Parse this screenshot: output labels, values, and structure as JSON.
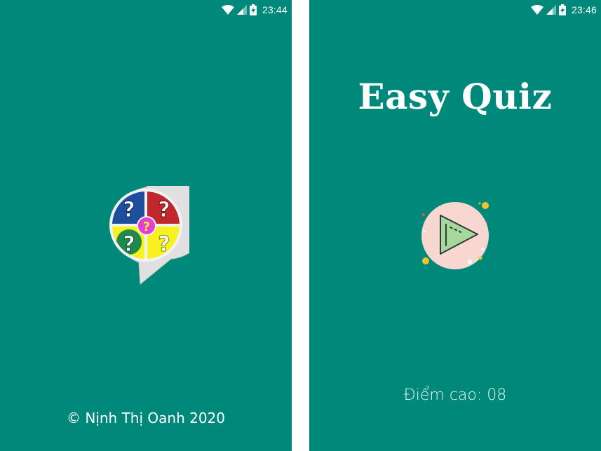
{
  "colors": {
    "background": "#00897b",
    "divider": "#ffffff",
    "text": "#ffffff",
    "play_circle": "#f8d7d0",
    "play_triangle": "#a6d89b",
    "dot_yellow": "#f2c230",
    "dot_red": "#e4574c"
  },
  "screen_splash": {
    "status_bar": {
      "time": "23:44",
      "icons": [
        "wifi-icon",
        "cell-signal-icon",
        "battery-charging-icon"
      ]
    },
    "logo_icon": "quiz-speech-bubble-logo-icon",
    "copyright": "© Nịnh Thị Oanh 2020"
  },
  "screen_home": {
    "status_bar": {
      "time": "23:46",
      "icons": [
        "wifi-icon",
        "cell-signal-icon",
        "battery-charging-icon"
      ]
    },
    "title": "Easy Quiz",
    "play_icon": "play-button-icon",
    "high_score": {
      "label": "Điểm cao:",
      "value": "08"
    }
  }
}
